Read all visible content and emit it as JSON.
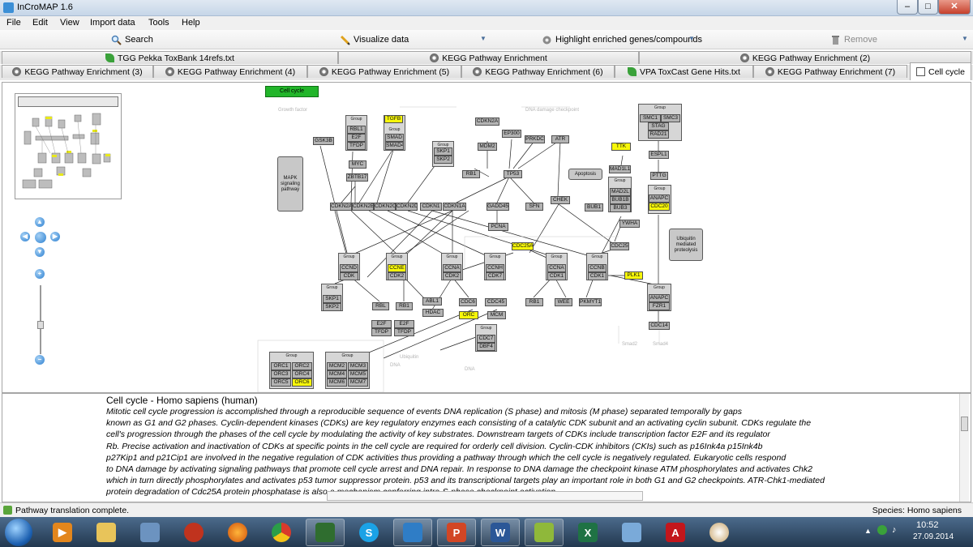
{
  "window": {
    "title": "InCroMAP 1.6",
    "minimize": "‒",
    "maximize": "□",
    "close": "✕"
  },
  "menu": [
    "File",
    "Edit",
    "View",
    "Import data",
    "Tools",
    "Help"
  ],
  "toolbar": {
    "search": "Search",
    "visualize": "Visualize data",
    "highlight": "Highlight enriched genes/compounds",
    "remove": "Remove"
  },
  "tabs_row1": [
    "TGG Pekka ToxBank 14refs.txt",
    "KEGG Pathway Enrichment",
    "KEGG Pathway Enrichment (2)"
  ],
  "tabs_row2": [
    "KEGG Pathway Enrichment (3)",
    "KEGG Pathway Enrichment (4)",
    "KEGG Pathway Enrichment (5)",
    "KEGG Pathway Enrichment (6)",
    "VPA ToxCast Gene Hits.txt",
    "KEGG Pathway Enrichment (7)",
    "Cell cycle"
  ],
  "pathway": {
    "title_node": "Cell cycle",
    "genes": [
      {
        "id": "gsk3b",
        "label": "GSK3B"
      },
      {
        "id": "rbl1",
        "label": "RBL1"
      },
      {
        "id": "e2f-a",
        "label": "E2F"
      },
      {
        "id": "tfdp-a",
        "label": "TFDP"
      },
      {
        "id": "tgfb",
        "label": "TGFB"
      },
      {
        "id": "smad-a",
        "label": "SMAD"
      },
      {
        "id": "smad4",
        "label": "SMAD4"
      },
      {
        "id": "myc",
        "label": "MYC"
      },
      {
        "id": "zbtb17",
        "label": "ZBTB17"
      },
      {
        "id": "skp1-a",
        "label": "SKP1"
      },
      {
        "id": "skp2-a",
        "label": "SKP2"
      },
      {
        "id": "cdkn2a",
        "label": "CDKN2A"
      },
      {
        "id": "ep300",
        "label": "EP300"
      },
      {
        "id": "mdm2",
        "label": "MDM2"
      },
      {
        "id": "prkdc",
        "label": "PRKDC"
      },
      {
        "id": "atr",
        "label": "ATR"
      },
      {
        "id": "rb1-a",
        "label": "RB1"
      },
      {
        "id": "tp53",
        "label": "TP53"
      },
      {
        "id": "cdkn2a2",
        "label": "CDKN2A"
      },
      {
        "id": "cdkn2b",
        "label": "CDKN2B"
      },
      {
        "id": "cdkn2c",
        "label": "CDKN2C"
      },
      {
        "id": "cdkn2d",
        "label": "CDKN2D"
      },
      {
        "id": "cdkn1",
        "label": "CDKN1"
      },
      {
        "id": "cdkn1a",
        "label": "CDKN1A"
      },
      {
        "id": "gadd45",
        "label": "GADD45"
      },
      {
        "id": "sfn",
        "label": "SFN"
      },
      {
        "id": "chek",
        "label": "CHEK"
      },
      {
        "id": "pcna",
        "label": "PCNA"
      },
      {
        "id": "ttk",
        "label": "TTK"
      },
      {
        "id": "mad1l1",
        "label": "MAD1L1"
      },
      {
        "id": "mad2",
        "label": "MAD2L"
      },
      {
        "id": "bub1b",
        "label": "BUB1B"
      },
      {
        "id": "bub3",
        "label": "BUB3"
      },
      {
        "id": "bub1",
        "label": "BUB1"
      },
      {
        "id": "ywha",
        "label": "YWHA"
      },
      {
        "id": "smc1",
        "label": "SMC1"
      },
      {
        "id": "smc3",
        "label": "SMC3"
      },
      {
        "id": "stag",
        "label": "STAG"
      },
      {
        "id": "rad21",
        "label": "RAD21"
      },
      {
        "id": "espl1",
        "label": "ESPL1"
      },
      {
        "id": "pttg",
        "label": "PTTG"
      },
      {
        "id": "anapc-a",
        "label": "ANAPC"
      },
      {
        "id": "cdc20",
        "label": "CDC20"
      },
      {
        "id": "ccnd",
        "label": "CCND"
      },
      {
        "id": "cdk-d",
        "label": "CDK"
      },
      {
        "id": "ccne",
        "label": "CCNE"
      },
      {
        "id": "cdk2-e",
        "label": "CDK2"
      },
      {
        "id": "ccna-a",
        "label": "CCNA"
      },
      {
        "id": "cdk2-a",
        "label": "CDK2"
      },
      {
        "id": "ccnh",
        "label": "CCNH"
      },
      {
        "id": "cdk7",
        "label": "CDK7"
      },
      {
        "id": "cdc25a",
        "label": "CDC25A"
      },
      {
        "id": "ccna-b",
        "label": "CCNA"
      },
      {
        "id": "cdk1-a",
        "label": "CDK1"
      },
      {
        "id": "ccnb",
        "label": "CCNB"
      },
      {
        "id": "cdk1-b",
        "label": "CDK1"
      },
      {
        "id": "cdc25",
        "label": "CDC25"
      },
      {
        "id": "plk1",
        "label": "PLK1"
      },
      {
        "id": "skp1-b",
        "label": "SKP1"
      },
      {
        "id": "skp2-b",
        "label": "SKP2"
      },
      {
        "id": "rbl-b",
        "label": "RBL"
      },
      {
        "id": "rb1-b",
        "label": "RB1"
      },
      {
        "id": "e2f-b",
        "label": "E2F"
      },
      {
        "id": "tfdp-b",
        "label": "TFDP"
      },
      {
        "id": "e2f-c",
        "label": "E2F"
      },
      {
        "id": "tfdp-c",
        "label": "TFDP"
      },
      {
        "id": "abl1",
        "label": "ABL1"
      },
      {
        "id": "hdac",
        "label": "HDAC"
      },
      {
        "id": "cdc6",
        "label": "CDC6"
      },
      {
        "id": "cdc45",
        "label": "CDC45"
      },
      {
        "id": "orc",
        "label": "ORC"
      },
      {
        "id": "mcm",
        "label": "MCM"
      },
      {
        "id": "cdc7",
        "label": "CDC7"
      },
      {
        "id": "dbf4",
        "label": "DBF4"
      },
      {
        "id": "rb1-c",
        "label": "RB1"
      },
      {
        "id": "wee",
        "label": "WEE"
      },
      {
        "id": "pkmyt1",
        "label": "PKMYT1"
      },
      {
        "id": "anapc-b",
        "label": "ANAPC"
      },
      {
        "id": "fzr1",
        "label": "FZR1"
      },
      {
        "id": "cdc14",
        "label": "CDC14"
      },
      {
        "id": "orc1",
        "label": "ORC1"
      },
      {
        "id": "orc2",
        "label": "ORC2"
      },
      {
        "id": "orc3",
        "label": "ORC3"
      },
      {
        "id": "orc4",
        "label": "ORC4"
      },
      {
        "id": "orc5",
        "label": "ORC5"
      },
      {
        "id": "orc6",
        "label": "ORC6"
      },
      {
        "id": "mcm2",
        "label": "MCM2"
      },
      {
        "id": "mcm3",
        "label": "MCM3"
      },
      {
        "id": "mcm4",
        "label": "MCM4"
      },
      {
        "id": "mcm5",
        "label": "MCM5"
      },
      {
        "id": "mcm6",
        "label": "MCM6"
      },
      {
        "id": "mcm7",
        "label": "MCM7"
      }
    ],
    "group_label": "Group",
    "processes": {
      "mapk": "MAPK signaling pathway",
      "apoptosis": "Apoptosis",
      "ubiquitin": "Ubiquitin mediated proteolysis"
    }
  },
  "description": {
    "title": "Cell cycle - Homo sapiens (human)",
    "lines": [
      "Mitotic cell cycle progression is accomplished through a reproducible sequence of events DNA replication (S phase) and mitosis (M phase) separated temporally by gaps",
      "known as G1 and G2 phases. Cyclin-dependent kinases (CDKs) are key regulatory enzymes each consisting of a catalytic CDK subunit and an activating cyclin subunit. CDKs regulate the",
      "cell's progression through the phases of the cell cycle by modulating the activity of key substrates. Downstream targets of CDKs include transcription factor E2F and its regulator",
      "Rb. Precise activation and inactivation of CDKs at specific points in the cell cycle are required for orderly cell division. Cyclin-CDK inhibitors (CKIs) such as p16Ink4a p15Ink4b",
      "p27Kip1 and p21Cip1 are involved in the negative regulation of CDK activities thus providing a pathway through which the cell cycle is negatively regulated. Eukaryotic cells respond",
      "to DNA damage by activating signaling pathways that promote cell cycle arrest and DNA repair. In response to DNA damage the checkpoint kinase ATM phosphorylates and activates Chk2",
      "which in turn directly phosphorylates and activates p53 tumor suppressor protein. p53 and its transcriptional targets play an important role in both G1 and G2 checkpoints. ATR-Chk1-mediated",
      "protein degradation of Cdc25A protein phosphatase is also a mechanism conferring intra-S-phase checkpoint activation."
    ]
  },
  "status": {
    "message": "Pathway translation complete.",
    "species": "Species: Homo sapiens"
  },
  "taskbar": {
    "time": "10:52",
    "date": "27.09.2014"
  }
}
